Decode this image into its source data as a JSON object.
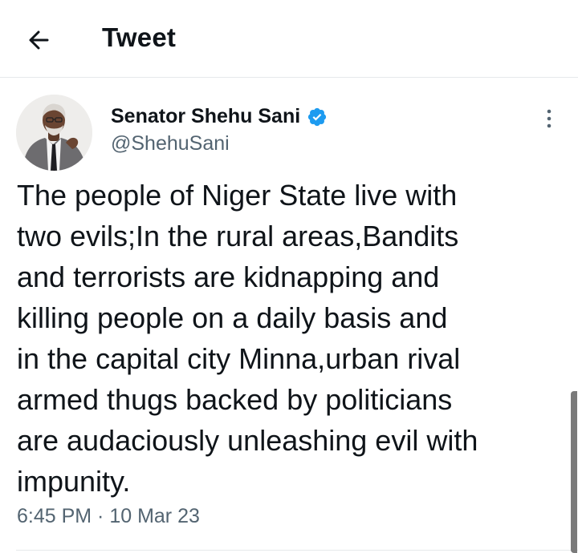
{
  "header": {
    "title": "Tweet",
    "back_icon": "arrow-left-icon"
  },
  "tweet": {
    "author_name": "Senator Shehu Sani",
    "author_handle": "@ShehuSani",
    "verified_icon": "verified-badge-icon",
    "more_icon": "more-vertical-icon",
    "text_lines": [
      "The people of Niger State live with",
      "two evils;In the rural areas,Bandits",
      "and terrorists are kidnapping and",
      "killing people on a daily basis and",
      "in the capital city Minna,urban rival",
      "armed thugs backed by politicians",
      "are audaciously unleashing evil with",
      "impunity."
    ],
    "timestamp": "6:45 PM · 10 Mar 23"
  },
  "colors": {
    "text": "#0f1419",
    "secondary_text": "#536471",
    "verified_blue": "#1d9bf0",
    "divider": "#e6e9eb"
  }
}
